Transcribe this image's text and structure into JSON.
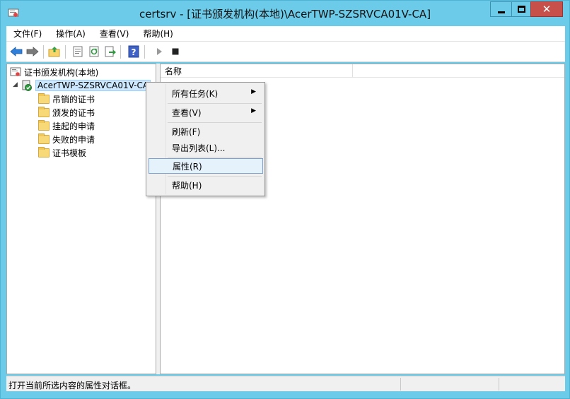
{
  "window": {
    "title": "certsrv - [证书颁发机构(本地)\\AcerTWP-SZSRVCA01V-CA]"
  },
  "menubar": {
    "items": [
      "文件(F)",
      "操作(A)",
      "查看(V)",
      "帮助(H)"
    ]
  },
  "toolbar": {
    "buttons": [
      "back-arrow-icon",
      "forward-arrow-icon",
      "up-folder-icon",
      "properties-icon",
      "refresh-icon",
      "export-icon",
      "help-icon",
      "start-service-icon",
      "stop-service-icon"
    ]
  },
  "tree": {
    "root": "证书颁发机构(本地)",
    "ca_node": "AcerTWP-SZSRVCA01V-CA",
    "children": [
      "吊销的证书",
      "颁发的证书",
      "挂起的申请",
      "失败的申请",
      "证书模板"
    ]
  },
  "list": {
    "column_name": "名称"
  },
  "context_menu": {
    "all_tasks": "所有任务(K)",
    "view": "查看(V)",
    "refresh": "刷新(F)",
    "export_list": "导出列表(L)...",
    "properties": "属性(R)",
    "help": "帮助(H)"
  },
  "statusbar": {
    "text": "打开当前所选内容的属性对话框。"
  }
}
